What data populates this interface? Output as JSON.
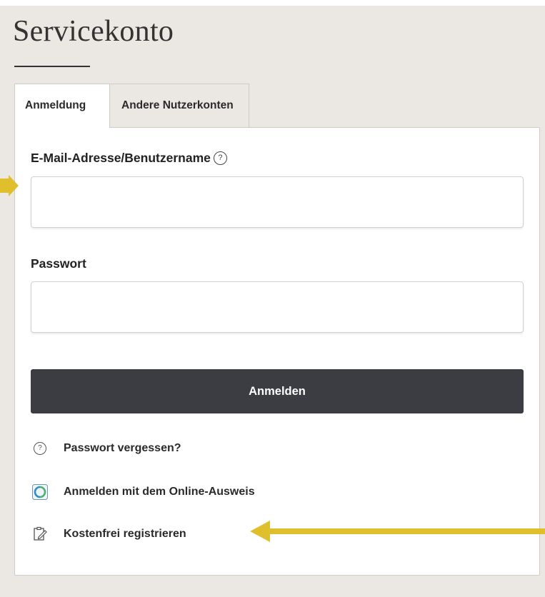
{
  "page": {
    "title": "Servicekonto"
  },
  "tabs": [
    {
      "label": "Anmeldung",
      "active": true
    },
    {
      "label": "Andere Nutzerkonten",
      "active": false
    }
  ],
  "form": {
    "email_label": "E-Mail-Adresse/Benutzername",
    "email_value": "",
    "password_label": "Passwort",
    "password_value": "",
    "submit_label": "Anmelden"
  },
  "links": {
    "forgot_password": "Passwort vergessen?",
    "online_id": "Anmelden mit dem Online-Ausweis",
    "register": "Kostenfrei registrieren"
  },
  "icons": {
    "help": "help-circle-icon",
    "question": "question-circle-icon",
    "online_id": "online-ausweis-icon",
    "register": "edit-form-icon",
    "annotation_arrows": "arrow-icon"
  },
  "colors": {
    "page_background": "#ebe8e3",
    "button_background": "#3c3d42",
    "annotation_arrow": "#e0bf2c"
  }
}
